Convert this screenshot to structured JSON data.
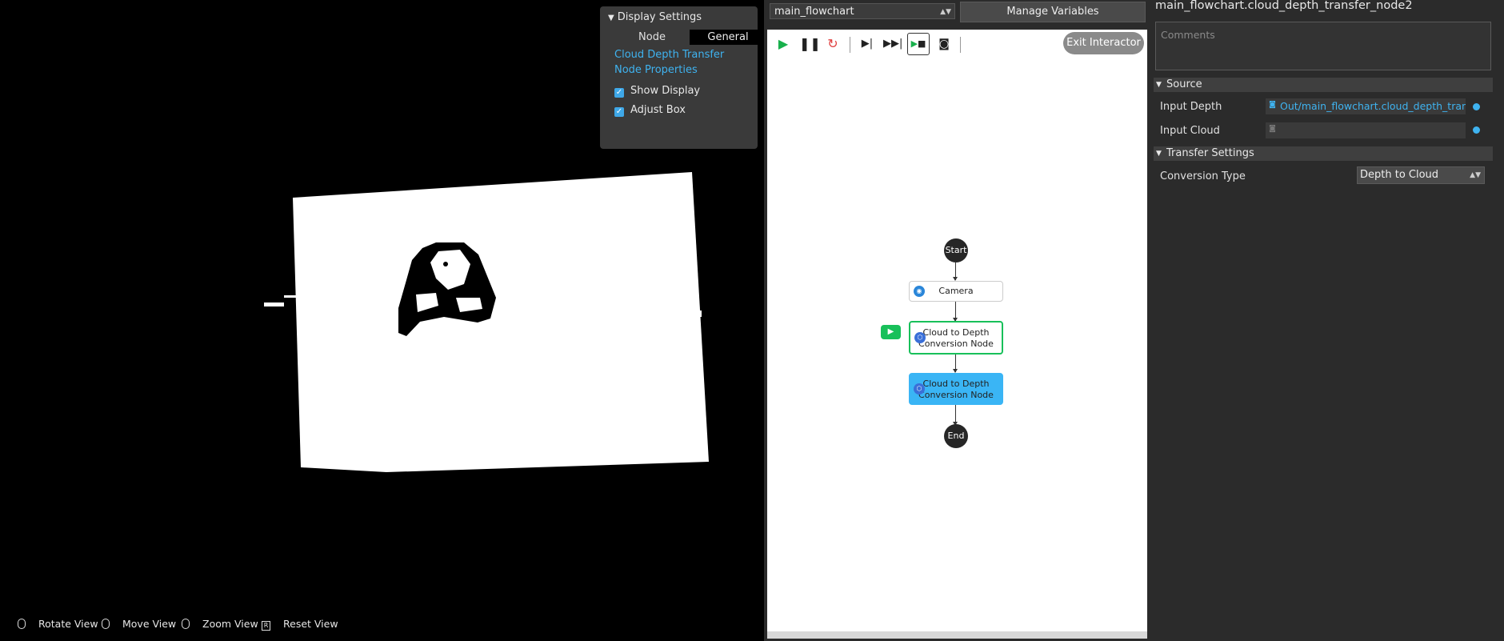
{
  "viewport": {
    "display_settings": {
      "title": "Display Settings",
      "tabs": [
        "Node",
        "General"
      ],
      "selected_tab": "General",
      "link_line1": "Cloud Depth Transfer",
      "link_line2": "Node Properties",
      "show_display": {
        "label": "Show Display",
        "checked": true
      },
      "adjust_box": {
        "label": "Adjust Box",
        "checked": true
      }
    },
    "controls": {
      "rotate": "Rotate View",
      "move": "Move View",
      "zoom": "Zoom View",
      "reset_key": "R",
      "reset": "Reset View"
    }
  },
  "flowchart": {
    "selected_flow": "main_flowchart",
    "manage_variables": "Manage Variables",
    "exit_interactor": "Exit Interactor",
    "toolbar": [
      "play-icon",
      "pause-icon",
      "restart-icon",
      "step-icon",
      "fast-forward-icon",
      "run-to-node-icon",
      "camera-capture-icon"
    ],
    "nodes": {
      "start": "Start",
      "camera": "Camera",
      "conv1_line1": "Cloud to Depth",
      "conv1_line2": "Conversion Node",
      "conv2_line1": "Cloud to Depth",
      "conv2_line2": "Conversion Node",
      "end": "End"
    },
    "colors": {
      "running": "#18c05a",
      "selected": "#3ab5f5"
    }
  },
  "properties": {
    "node_name": "main_flowchart.cloud_depth_transfer_node2",
    "comments_placeholder": "Comments",
    "source": {
      "title": "Source",
      "input_depth_label": "Input Depth",
      "input_depth_value": "Out/main_flowchart.cloud_depth_transfer",
      "input_cloud_label": "Input Cloud",
      "input_cloud_value": ""
    },
    "transfer_settings": {
      "title": "Transfer Settings",
      "conversion_type_label": "Conversion Type",
      "conversion_type_value": "Depth to Cloud"
    }
  }
}
